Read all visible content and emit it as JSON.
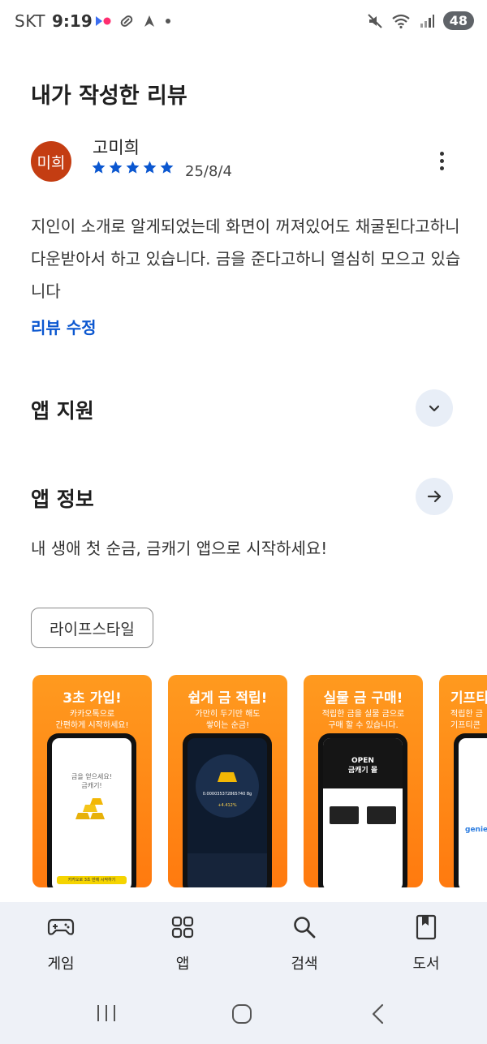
{
  "status_bar": {
    "carrier": "SKT",
    "time": "9:19",
    "battery": "48"
  },
  "review_section": {
    "heading": "내가 작성한 리뷰",
    "avatar_text": "미희",
    "reviewer_name": "고미희",
    "rating": 5,
    "date": "25/8/4",
    "text": "지인이 소개로 알게되었는데 화면이 꺼져있어도 채굴된다고하니 다운받아서 하고 있습니다. 금을 준다고하니 열심히 모으고 있습니다",
    "edit_label": "리뷰 수정"
  },
  "app_support": {
    "title": "앱 지원"
  },
  "app_info": {
    "title": "앱 정보",
    "description": "내 생애 첫 순금, 금캐기 앱으로 시작하세요!",
    "category_chip": "라이프스타일"
  },
  "screenshots": [
    {
      "title": "3초 가입!",
      "subtitle": "카카오톡으로\n간편하게 시작하세요!",
      "screen_text": "금을 얻으세요!\n금캐기!",
      "button_text": "카카오로 3초 만에 시작하기"
    },
    {
      "title": "쉽게 금 적립!",
      "subtitle": "가만히 두기만 해도\n쌓이는 순금!",
      "screen_value": "0.000035372865740 8g",
      "screen_pct": "+4.412%"
    },
    {
      "title": "실물 금 구매!",
      "subtitle": "적립한 금을 실물 금으로\n구매 할 수 있습니다.",
      "screen_text": "OPEN\n금캐기 몰"
    },
    {
      "title": "기프티",
      "subtitle": "적립한 금\n기프티콘",
      "screen_text": "genie"
    }
  ],
  "bottom_nav": {
    "items": [
      {
        "label": "게임",
        "icon": "gamepad-icon"
      },
      {
        "label": "앱",
        "icon": "apps-grid-icon"
      },
      {
        "label": "검색",
        "icon": "search-icon"
      },
      {
        "label": "도서",
        "icon": "book-icon"
      }
    ]
  },
  "colors": {
    "accent": "#0b57d0",
    "star": "#0b57d0",
    "avatar": "#c43d12",
    "shot_orange": "#ff8a1a",
    "nav_bg": "#eef1f7"
  }
}
